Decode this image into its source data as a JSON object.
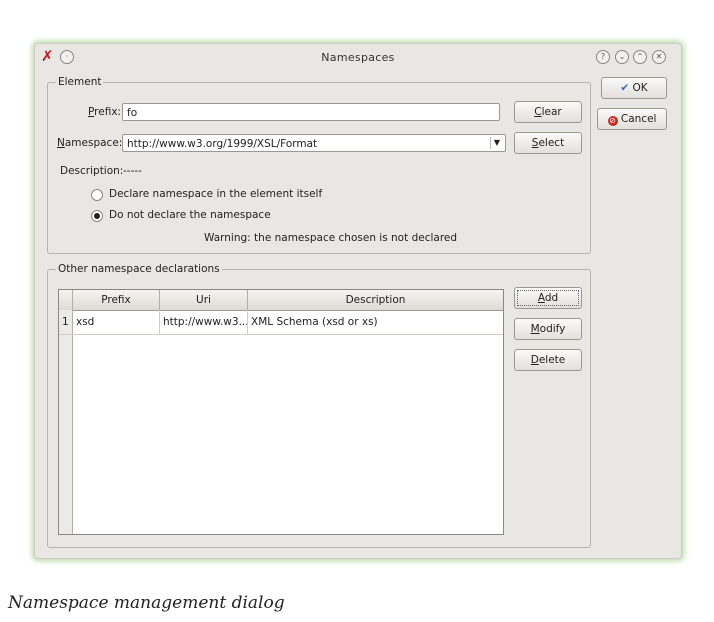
{
  "window": {
    "title": "Namespaces",
    "app_icon": "✗",
    "titlebar_buttons": [
      "?",
      "⌄",
      "⌃",
      "✕"
    ]
  },
  "element": {
    "legend": "Element",
    "prefix_label": "Prefix:",
    "prefix_value": "fo",
    "clear_label": "Clear",
    "namespace_label": "Namespace:",
    "namespace_value": "http://www.w3.org/1999/XSL/Format",
    "select_label": "Select",
    "description_label": "Description:",
    "description_value": "-----",
    "radio1_label": "Declare namespace in the element itself",
    "radio2_label": "Do not declare the namespace",
    "warning": "Warning: the namespace chosen is not declared"
  },
  "other": {
    "legend": "Other namespace declarations",
    "columns": [
      "Prefix",
      "Uri",
      "Description"
    ],
    "rows": [
      {
        "num": "1",
        "prefix": "xsd",
        "uri": "http://www.w3...",
        "description": "XML Schema (xsd or xs)"
      }
    ],
    "add_label": "Add",
    "modify_label": "Modify",
    "delete_label": "Delete"
  },
  "side_buttons": {
    "ok_label": "OK",
    "cancel_label": "Cancel"
  },
  "caption": "Namespace management dialog",
  "colors": {
    "window_bg": "#e9e7e3",
    "glow": "#b7dba8",
    "ok_check": "#3f67b0",
    "cancel_red": "#c8281e"
  }
}
